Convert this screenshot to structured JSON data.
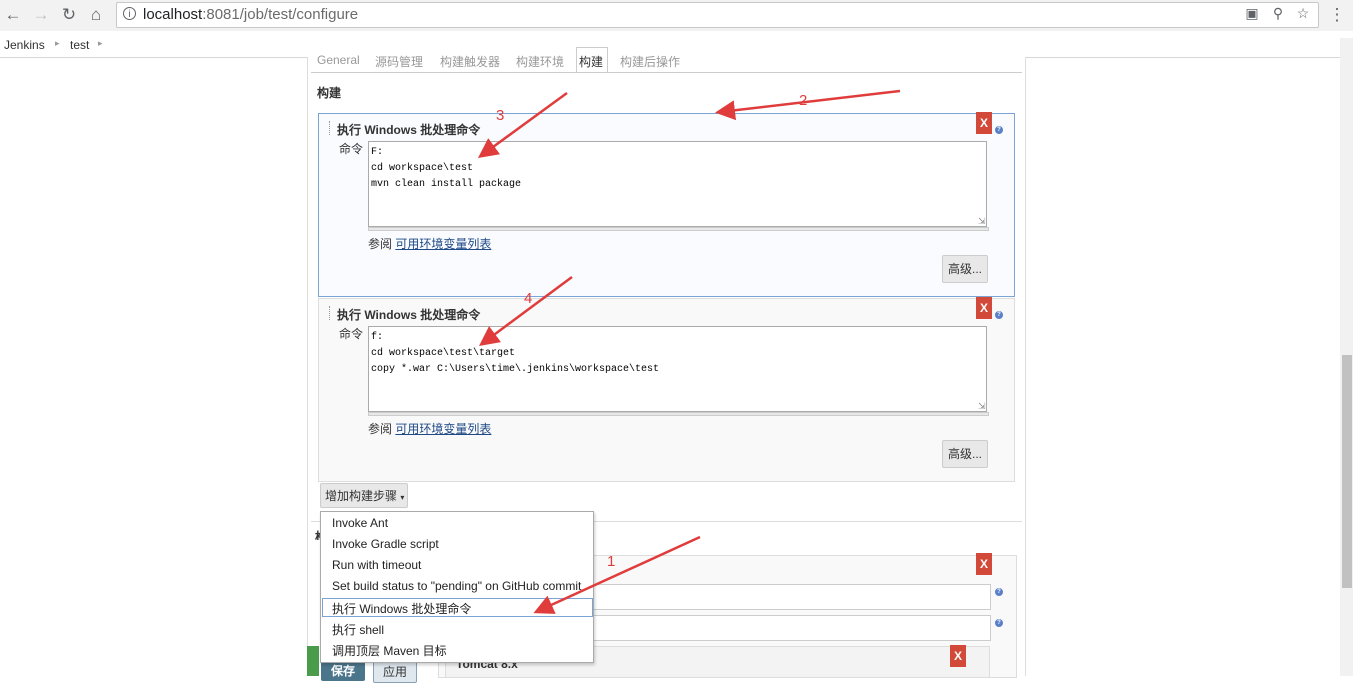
{
  "browser": {
    "url_host": "localhost",
    "url_rest": ":8081/job/test/configure"
  },
  "breadcrumbs": [
    "Jenkins",
    "test"
  ],
  "tabs": [
    "General",
    "源码管理",
    "构建触发器",
    "构建环境",
    "构建",
    "构建后操作"
  ],
  "active_tab": "构建",
  "section_title": "构建",
  "steps": [
    {
      "title": "执行 Windows 批处理命令",
      "command_label": "命令",
      "command": "F:\ncd workspace\\test\nmvn clean install package",
      "see_also": "参阅",
      "env_link": "可用环境变量列表",
      "advanced_label": "高级..."
    },
    {
      "title": "执行 Windows 批处理命令",
      "command_label": "命令",
      "command": "f:\ncd workspace\\test\\target\ncopy *.war C:\\Users\\time\\.jenkins\\workspace\\test",
      "see_also": "参阅",
      "env_link": "可用环境变量列表",
      "advanced_label": "高级..."
    }
  ],
  "delete_label": "X",
  "add_step_label": "增加构建步骤",
  "menu_items": [
    "Invoke Ant",
    "Invoke Gradle script",
    "Run with timeout",
    "Set build status to \"pending\" on GitHub commit",
    "执行 Windows 批处理命令",
    "执行 shell",
    "调用顶层 Maven 目标"
  ],
  "highlighted_menu_item": "执行 Windows 批处理命令",
  "tomcat_label": "Tomcat 8.x",
  "save_label": "保存",
  "apply_label": "应用",
  "annotations": [
    "1",
    "2",
    "3",
    "4"
  ],
  "colors": {
    "annotation_red": "#e03c3c",
    "delete_red": "#d24939",
    "save_blue": "#4b758b",
    "link_blue": "#204a87"
  }
}
